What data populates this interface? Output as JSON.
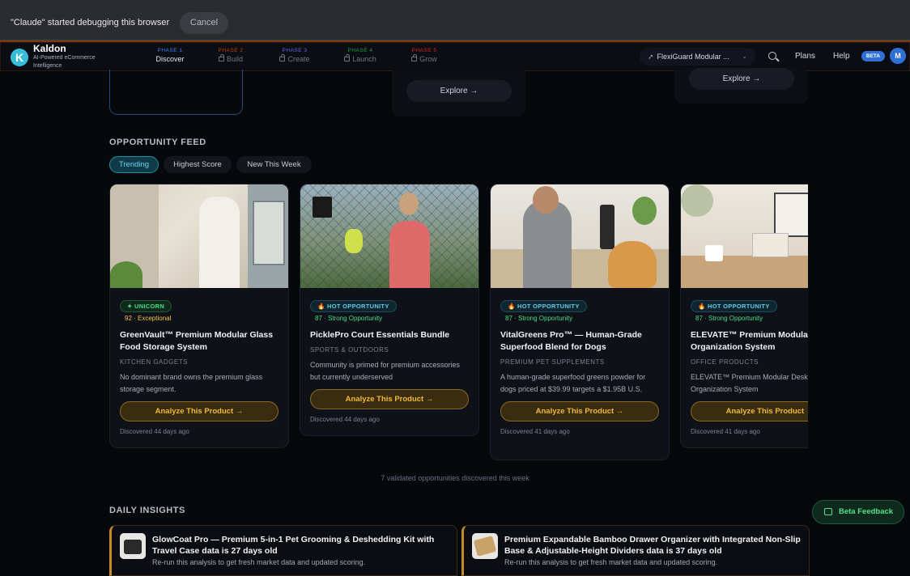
{
  "debug_bar": {
    "message": "\"Claude\" started debugging this browser",
    "cancel_label": "Cancel"
  },
  "brand": {
    "name": "Kaldon",
    "logo_letter": "K",
    "tagline": "AI-Powered eCommerce Intelligence"
  },
  "phases": [
    {
      "label": "PHASE 1",
      "name": "Discover",
      "color": "#3b82f6",
      "active": true
    },
    {
      "label": "PHASE 2",
      "name": "Build",
      "color": "#c2410c",
      "active": false
    },
    {
      "label": "PHASE 3",
      "name": "Create",
      "color": "#6366f1",
      "active": false
    },
    {
      "label": "PHASE 4",
      "name": "Launch",
      "color": "#16a34a",
      "active": false
    },
    {
      "label": "PHASE 5",
      "name": "Grow",
      "color": "#dc2626",
      "active": false
    }
  ],
  "header": {
    "product_selector": "FlexiGuard Modular ...",
    "plans": "Plans",
    "help": "Help",
    "beta_badge": "BETA",
    "avatar_initial": "M"
  },
  "top_cards": {
    "explore_label": "Explore"
  },
  "opportunity_feed": {
    "title": "OPPORTUNITY FEED",
    "tabs": [
      {
        "label": "Trending",
        "active": true
      },
      {
        "label": "Highest Score",
        "active": false
      },
      {
        "label": "New This Week",
        "active": false
      }
    ],
    "cards": [
      {
        "badge": "UNICORN",
        "badge_type": "unicorn",
        "score_text": "92 · Exceptional",
        "score_color": "#f2c744",
        "title": "GreenVault™ Premium Modular Glass Food Storage System",
        "category": "KITCHEN GADGETS",
        "description": "No dominant brand owns the premium glass storage segment.",
        "button": "Analyze This Product →",
        "discovered": "Discovered 44 days ago"
      },
      {
        "badge": "HOT OPPORTUNITY",
        "badge_type": "hot",
        "score_text": "87 · Strong Opportunity",
        "score_color": "#4ade80",
        "title": "PicklePro Court Essentials Bundle",
        "category": "SPORTS & OUTDOORS",
        "description": "Community is primed for premium accessories but currently underserved",
        "button": "Analyze This Product →",
        "discovered": "Discovered 44 days ago"
      },
      {
        "badge": "HOT OPPORTUNITY",
        "badge_type": "hot",
        "score_text": "87 · Strong Opportunity",
        "score_color": "#4ade80",
        "title": "VitalGreens Pro™ — Human-Grade Superfood Blend for Dogs",
        "category": "PREMIUM PET SUPPLEMENTS",
        "description": "A human-grade superfood greens powder for dogs priced at $39.99 targets a $1.95B U.S.",
        "button": "Analyze This Product →",
        "discovered": "Discovered 41 days ago"
      },
      {
        "badge": "HOT OPPORTUNITY",
        "badge_type": "hot",
        "score_text": "87 · Strong Opportunity",
        "score_color": "#4ade80",
        "title": "ELEVATE™ Premium Modular Desk Organization System",
        "category": "OFFICE PRODUCTS",
        "description": "ELEVATE™ Premium Modular Desk Organization System",
        "button": "Analyze This Product →",
        "discovered": "Discovered 41 days ago"
      }
    ],
    "footer_note": "7 validated opportunities discovered this week"
  },
  "daily_insights": {
    "title": "DAILY INSIGHTS",
    "items": [
      {
        "title": "GlowCoat Pro — Premium 5-in-1 Pet Grooming & Deshedding Kit with Travel Case data is 27 days old",
        "subtitle": "Re-run this analysis to get fresh market data and updated scoring."
      },
      {
        "title": "Premium Expandable Bamboo Drawer Organizer with Integrated Non-Slip Base & Adjustable-Height Dividers data is 37 days old",
        "subtitle": "Re-run this analysis to get fresh market data and updated scoring."
      }
    ]
  },
  "beta_feedback": "Beta Feedback"
}
